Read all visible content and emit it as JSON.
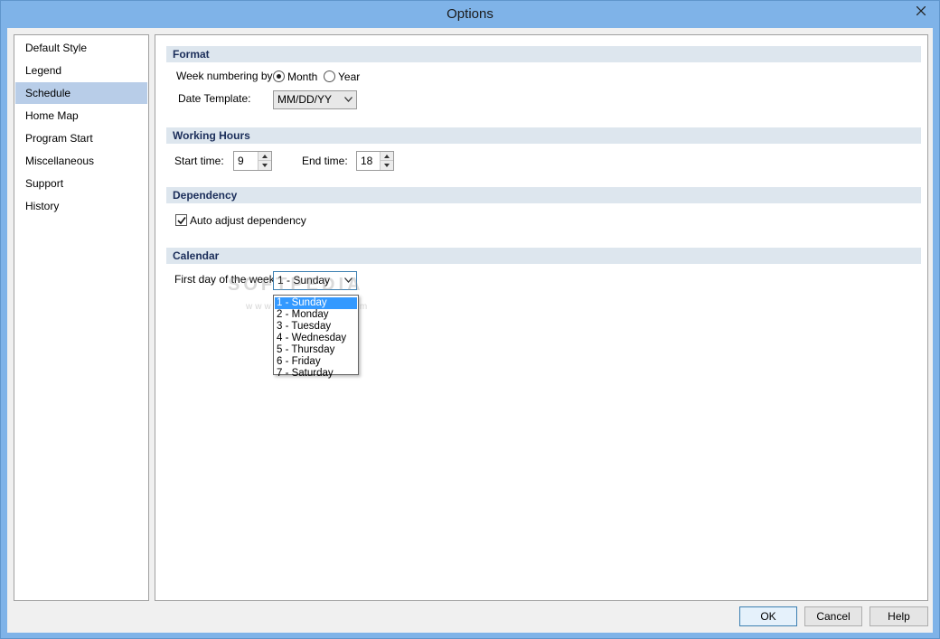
{
  "window": {
    "title": "Options"
  },
  "nav": {
    "items": [
      {
        "label": "Default Style"
      },
      {
        "label": "Legend"
      },
      {
        "label": "Schedule"
      },
      {
        "label": "Home Map"
      },
      {
        "label": "Program Start"
      },
      {
        "label": "Miscellaneous"
      },
      {
        "label": "Support"
      },
      {
        "label": "History"
      }
    ],
    "selected": "Schedule"
  },
  "format": {
    "header": "Format",
    "week_numbering_label": "Week numbering by",
    "month_label": "Month",
    "year_label": "Year",
    "week_numbering_value": "Month",
    "date_template_label": "Date Template:",
    "date_template_value": "MM/DD/YY"
  },
  "working_hours": {
    "header": "Working Hours",
    "start_label": "Start time:",
    "start_value": "9",
    "end_label": "End time:",
    "end_value": "18"
  },
  "dependency": {
    "header": "Dependency",
    "auto_adjust_label": "Auto adjust dependency",
    "auto_adjust_checked": true
  },
  "calendar": {
    "header": "Calendar",
    "first_day_label": "First day of the week:",
    "first_day_value": "1 - Sunday",
    "options": [
      "1 - Sunday",
      "2 - Monday",
      "3 - Tuesday",
      "4 - Wednesday",
      "5 - Thursday",
      "6 - Friday",
      "7 - Saturday"
    ],
    "highlighted_option": "1 - Sunday"
  },
  "watermark": {
    "line1": "SOFTPEDIA",
    "line2": "www.softpedia.com"
  },
  "buttons": {
    "ok": "OK",
    "cancel": "Cancel",
    "help": "Help"
  },
  "colors": {
    "selection": "#b8cde8",
    "section_header": "#dde6ee",
    "list_highlight": "#3399ff",
    "titlebar": "#7fb3e8"
  }
}
